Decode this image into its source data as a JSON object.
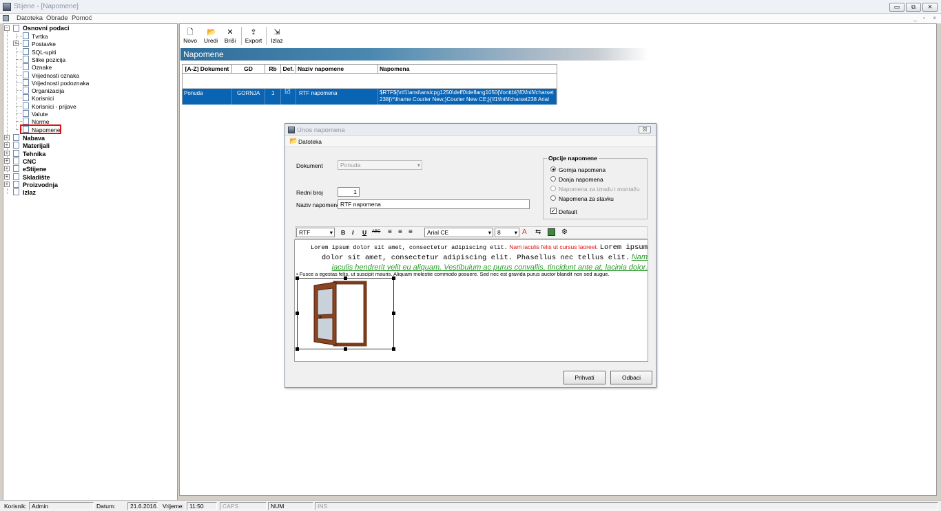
{
  "window": {
    "title": "Stijene - [Napomene]",
    "minimize": "▭",
    "restore": "⧉",
    "close": "✕"
  },
  "menu": {
    "items": [
      "Datoteka",
      "Obrade",
      "Pomoć"
    ],
    "mdi_controls": [
      "_",
      "▫",
      "×"
    ]
  },
  "tree": {
    "root": "Osnovni podaci",
    "children": [
      "Tvrtka",
      "Postavke",
      "SQL-upiti",
      "Slike pozicija",
      "Oznake",
      "Vrijednosti oznaka",
      "Vrijednosti podoznaka",
      "Organizacija",
      "Korisnici",
      "Korisnici - prijave",
      "Valute",
      "Norme",
      "Napomene"
    ],
    "top": [
      "Nabava",
      "Materijali",
      "Tehnika",
      "CNC",
      "eStijene",
      "Skladište",
      "Proizvodnja",
      "Izlaz"
    ]
  },
  "toolbar": {
    "novo": "Novo",
    "uredi": "Uredi",
    "brisi": "Briši",
    "export": "Export",
    "izlaz": "Izlaz"
  },
  "banner": {
    "title": "Napomene"
  },
  "grid": {
    "headers": [
      "[A-Z] Dokument",
      "GD",
      "Rb",
      "Def.",
      "Naziv napomene",
      "Napomena"
    ],
    "row": {
      "dokument": "Ponuda",
      "gd": "GORNJA",
      "rb": "1",
      "def": "☑",
      "naziv": "RTF napomena",
      "napomena_l1": "$RTF${\\rtf1\\ansi\\ansicpg1250\\deff0\\deflang1050{\\fonttbl{\\f0\\fnil\\fcharset",
      "napomena_l2": "238{\\*\\fname Courier New;}Courier New CE;}{\\f1\\fnil\\fcharset238 Arial"
    }
  },
  "dialog": {
    "title": "Unos napomena",
    "close": "☒",
    "menu": "Datoteka",
    "dokument_label": "Dokument",
    "dokument_value": "Ponuda",
    "redni_broj_label": "Redni broj",
    "redni_broj_value": "1",
    "naziv_label": "Naziv napomene",
    "naziv_value": "RTF napomena",
    "opcije_title": "Opcije napomene",
    "opcije": [
      "Gornja napomena",
      "Donja napomena",
      "Napomena za izradu i montažu",
      "Napomena za stavku"
    ],
    "default_label": "Default",
    "default_check": "✓",
    "rtf_style": "RTF",
    "bold": "B",
    "italic": "I",
    "underline": "U",
    "strike": "ABC",
    "font": "Arial CE",
    "size": "8",
    "editor": {
      "p1_courier_a": "Lorem ipsum dolor sit amet, consectetur adipiscing elit.",
      "p1_red": "Nam iaculis felis ut cursus laoreet.",
      "p1_courier_b": "Lorem ipsum dolor sit amet, consectetur adipiscing elit. Phasellus nec tellus elit.",
      "p1_green": "Nam iaculis hendrerit velit eu aliquam. Vestibulum ac purus convallis, tincidunt ante at, lacinia dolor.",
      "bullet": "Fusce a egestas felis, ut suscipit mauris. Aliquam molestie commodo posuere. Sed nec est gravida purus auctor blandit non sed augue."
    },
    "ok": "Prihvati",
    "cancel": "Odbaci"
  },
  "status": {
    "korisnik_label": "Korisnik:",
    "korisnik": "Admin",
    "datum_label": "Datum:",
    "datum": "21.6.2016.",
    "vrijeme_label": "Vrijeme:",
    "vrijeme": "11:50",
    "caps": "CAPS",
    "num": "NUM",
    "ins": "INS"
  },
  "colors": {
    "selection": "#0a64b4",
    "highlight_box": "#e01010",
    "red_text": "#e01010",
    "green_text": "#2a9a2a"
  }
}
